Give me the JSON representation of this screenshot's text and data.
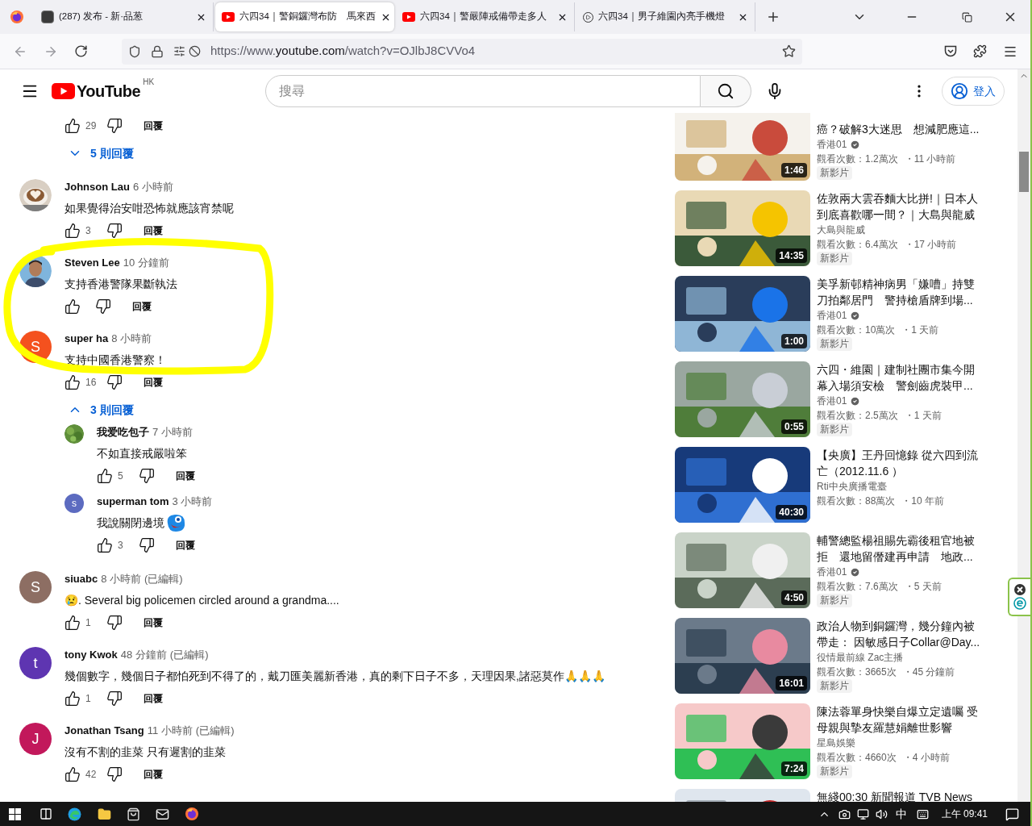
{
  "browser": {
    "tabs": [
      {
        "kind": "site",
        "title": "(287) 发布 - 新·品葱",
        "selected": false
      },
      {
        "kind": "youtube",
        "title": "六四34｜警銅鑼灣布防　馬來西",
        "selected": true
      },
      {
        "kind": "youtube",
        "title": "六四34｜警嚴陣戒備帶走多人",
        "selected": false
      },
      {
        "kind": "playing",
        "title": "六四34｜男子維園內亮手機燈",
        "selected": false
      }
    ],
    "url_start": "https://www.",
    "url_host": "youtube.com",
    "url_end": "/watch?v=OJlbJ8CVVo4"
  },
  "youtube": {
    "logo": "YouTube",
    "region": "HK",
    "search_placeholder": "搜尋",
    "sign_in": "登入"
  },
  "comments": [
    {
      "kind": "actions",
      "likes": "29",
      "reply": "回覆",
      "replies": {
        "label": "5 則回覆",
        "expanded": false
      }
    },
    {
      "kind": "comment",
      "author": "Johnson Lau",
      "time": "6 小時前",
      "text": "如果覺得治安咁恐怖就應該宵禁呢",
      "likes": "3",
      "reply": "回覆"
    },
    {
      "kind": "comment",
      "author": "Steven Lee",
      "time": "10 分鐘前",
      "text": "支持香港警隊果斷執法",
      "reply": "回覆"
    },
    {
      "kind": "comment",
      "author": "super ha",
      "time": "8 小時前",
      "text": "支持中國香港警察！",
      "likes": "16",
      "reply": "回覆",
      "avatar": {
        "kind": "letter",
        "letter": "S",
        "color": "#f4511e"
      },
      "replies": {
        "label": "3 則回覆",
        "expanded": true,
        "items": [
          {
            "kind": "comment",
            "author": "我爱吃包子",
            "time": "7 小時前",
            "text": "不如直接戒嚴啦笨",
            "likes": "5",
            "reply": "回覆"
          },
          {
            "kind": "comment",
            "author": "superman tom",
            "time": "3 小時前",
            "text": "我說關閉邊境",
            "sticker": true,
            "likes": "3",
            "reply": "回覆",
            "avatar": {
              "kind": "letter",
              "letter": "s",
              "color": "#5c6bc0"
            }
          }
        ]
      }
    },
    {
      "kind": "comment",
      "author": "siuabc",
      "time": "8 小時前",
      "edited": "(已編輯)",
      "text": "😢. Several big policemen circled around a grandma....",
      "likes": "1",
      "reply": "回覆",
      "avatar": {
        "kind": "letter",
        "letter": "S",
        "color": "#8d6e63"
      }
    },
    {
      "kind": "comment",
      "author": "tony Kwok",
      "time": "48 分鐘前",
      "edited": "(已編輯)",
      "text": "幾個數字，幾個日子都怕死到不得了的，戴刀匯美麗新香港，真的剩下日子不多，天理因果,諸惡莫作🙏🙏🙏",
      "likes": "1",
      "reply": "回覆",
      "avatar": {
        "kind": "letter",
        "letter": "t",
        "color": "#5e35b1"
      }
    },
    {
      "kind": "comment",
      "author": "Jonathan Tsang",
      "time": "11 小時前",
      "edited": "(已編輯)",
      "text": "沒有不割的韭菜 只有遲割的韭菜",
      "likes": "42",
      "reply": "回覆",
      "avatar": {
        "kind": "letter",
        "letter": "J",
        "color": "#c2185b"
      }
    }
  ],
  "annotation": {
    "kind": "freehand-ellipse"
  },
  "sidebar": {
    "videos": [
      {
        "cut_top": true,
        "title_lines": [
          "癌？破解3大迷思　想減肥應這..."
        ],
        "channel": "香港01",
        "verified": true,
        "views": "觀看次數：1.2萬次",
        "age": "・11 小時前",
        "badge": "新影片",
        "duration": "1:46"
      },
      {
        "cut_top": false,
        "title_lines": [
          "佐敦兩大雲吞麵大比拼!｜日本人",
          "到底喜歡哪一間？｜大島與龍威"
        ],
        "channel": "大島與龍威",
        "verified": false,
        "views": "觀看次數：6.4萬次",
        "age": "・17 小時前",
        "badge": "新影片",
        "duration": "14:35"
      },
      {
        "cut_top": false,
        "title_lines": [
          "美孚新邨精神病男「嫌嘈」持雙",
          "刀拍鄰居門　警持槍盾牌到場..."
        ],
        "channel": "香港01",
        "verified": true,
        "views": "觀看次數：10萬次",
        "age": "・1 天前",
        "badge": "新影片",
        "duration": "1:00"
      },
      {
        "cut_top": false,
        "title_lines": [
          "六四・維園｜建制社團市集今開",
          "幕入場須安檢　警劍齒虎裝甲..."
        ],
        "channel": "香港01",
        "verified": true,
        "views": "觀看次數：2.5萬次",
        "age": "・1 天前",
        "badge": "新影片",
        "duration": "0:55"
      },
      {
        "cut_top": false,
        "title_lines": [
          "【央廣】王丹回憶錄 從六四到流",
          "亡（2012.11.6 ）"
        ],
        "channel": "Rti中央廣播電臺",
        "verified": false,
        "views": "觀看次數：88萬次",
        "age": "・10 年前",
        "duration": "40:30"
      },
      {
        "cut_top": false,
        "title_lines": [
          "輔警總監楊祖賜先霸後租官地被",
          "拒　還地留僭建再申請　地政..."
        ],
        "channel": "香港01",
        "verified": true,
        "views": "觀看次數：7.6萬次",
        "age": "・5 天前",
        "badge": "新影片",
        "duration": "4:50"
      },
      {
        "cut_top": false,
        "title_lines": [
          "政治人物到銅鑼灣，幾分鐘內被",
          "帶走： 因敏感日子Collar@Day..."
        ],
        "channel": "役情最前線 Zac主播",
        "verified": false,
        "views": "觀看次數：3665次",
        "age": "・45 分鐘前",
        "badge": "新影片",
        "duration": "16:01"
      },
      {
        "cut_top": false,
        "title_lines": [
          "陳法蓉單身快樂自爆立定遺囑 受",
          "母親與摯友羅慧娟離世影響"
        ],
        "channel": "星島娛樂",
        "verified": false,
        "views": "觀看次數：4660次",
        "age": "・4 小時前",
        "badge": "新影片",
        "duration": "7:24"
      },
      {
        "cut_top": false,
        "title_lines": [
          "無綫00:30 新聞報道 TVB News"
        ]
      }
    ]
  },
  "taskbar": {
    "ime": "中",
    "time": "上午 09:41"
  }
}
